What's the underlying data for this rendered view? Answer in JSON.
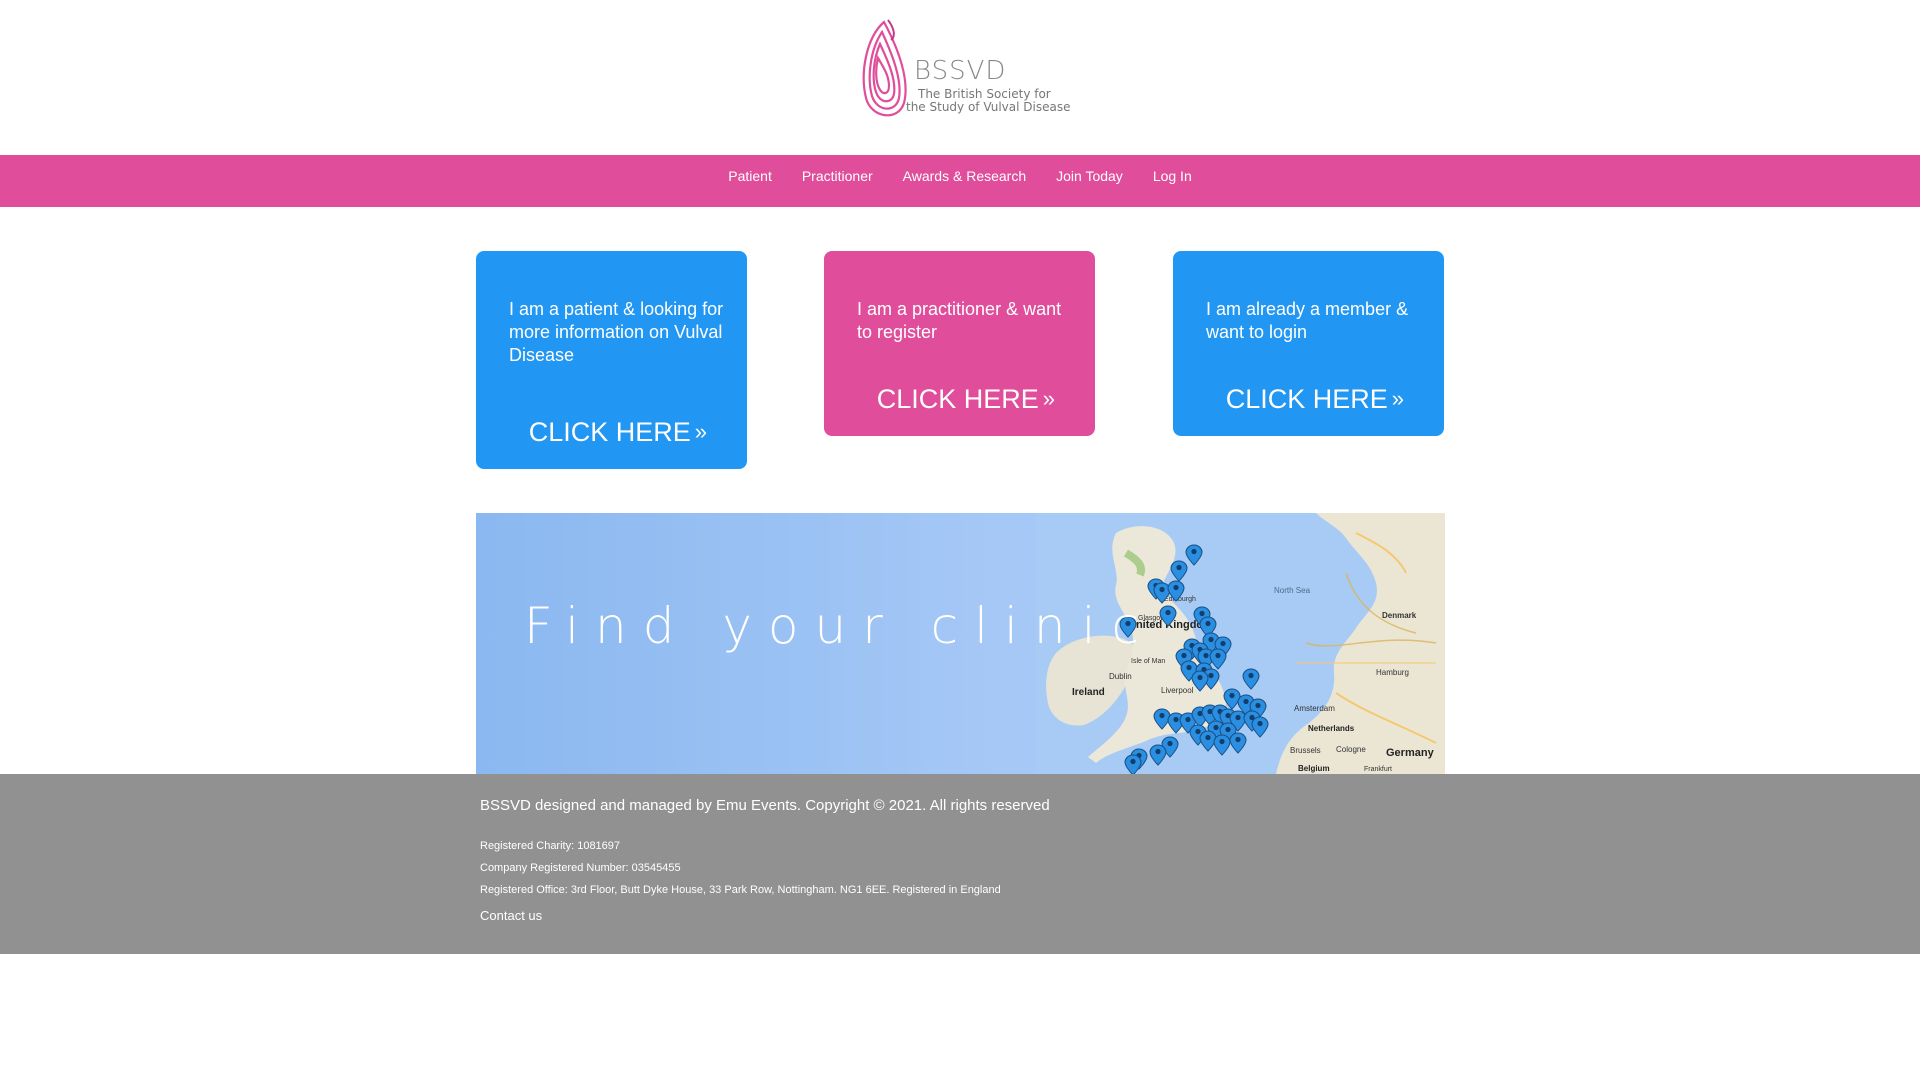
{
  "header": {
    "logo_name": "BSSVD",
    "logo_sub_line1": "The British Society for",
    "logo_sub_line2": "the Study of Vulval Disease",
    "brand_color": "#e04d9b"
  },
  "nav": {
    "items": [
      {
        "label": "Patient"
      },
      {
        "label": "Practitioner"
      },
      {
        "label": "Awards & Research"
      },
      {
        "label": "Join Today"
      },
      {
        "label": "Log In"
      }
    ]
  },
  "cards": [
    {
      "text": "I am a patient & looking for more information on Vulval Disease",
      "cta": "CLICK HERE",
      "color": "#2196f3"
    },
    {
      "text": "I am a practitioner & want to register",
      "cta": "CLICK HERE",
      "color": "#e04d9b"
    },
    {
      "text": "I am already a member & want to login",
      "cta": "CLICK HERE",
      "color": "#2196f3"
    }
  ],
  "banner": {
    "title": "Find your clinic",
    "map_labels": {
      "north_sea": "North Sea",
      "united_kingdom": "United Kingdom",
      "ireland": "Ireland",
      "dublin": "Dublin",
      "isle_of_man": "Isle of Man",
      "liverpool": "Liverpool",
      "glasgow": "Glasgow",
      "edinburgh": "Edinburgh",
      "denmark": "Denmark",
      "hamburg": "Hamburg",
      "amsterdam": "Amsterdam",
      "netherlands": "Netherlands",
      "belgium": "Belgium",
      "germany": "Germany",
      "cologne": "Cologne",
      "brussels": "Brussels",
      "frankfurt": "Frankfurt"
    }
  },
  "footer": {
    "copyright": "BSSVD designed and managed by Emu Events. Copyright © 2021. All rights reserved",
    "charity": "Registered Charity: 1081697",
    "company": "Company Registered Number: 03545455",
    "office": "Registered Office: 3rd Floor, Butt Dyke House, 33 Park Row, Nottingham. NG1 6EE. Registered in England",
    "contact": "Contact us"
  }
}
